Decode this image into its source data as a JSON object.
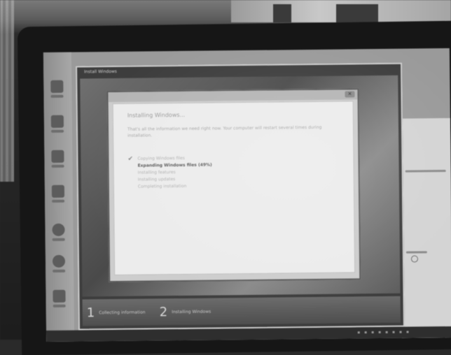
{
  "setup_window": {
    "title": "Install Windows",
    "dialog": {
      "heading": "Installing Windows...",
      "description": "That's all the information we need right now. Your computer will restart several times during installation.",
      "steps": [
        {
          "label": "Copying Windows files",
          "state": "done"
        },
        {
          "label": "Expanding Windows files (49%)",
          "state": "active"
        },
        {
          "label": "Installing features",
          "state": "pending"
        },
        {
          "label": "Installing updates",
          "state": "pending"
        },
        {
          "label": "Completing installation",
          "state": "pending"
        }
      ]
    },
    "phases": [
      {
        "number": "1",
        "label": "Collecting information"
      },
      {
        "number": "2",
        "label": "Installing Windows"
      }
    ]
  },
  "colors": {
    "desktop_gray": "#9a9a9a",
    "dialog_bg": "#ececec",
    "bezel": "#161616"
  },
  "icons": {
    "dialog_close": "close-icon",
    "step_done": "checkmark-icon",
    "desktop_sidebar": [
      "computer-icon",
      "folder-icon",
      "network-icon",
      "control-panel-icon",
      "help-icon",
      "internet-icon",
      "user-icon"
    ]
  }
}
